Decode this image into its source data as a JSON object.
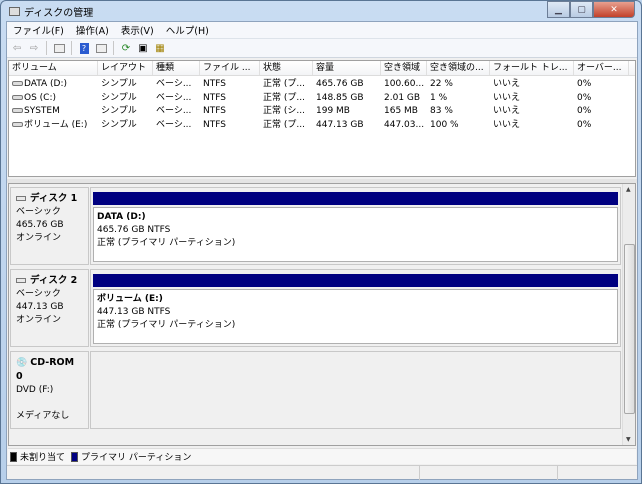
{
  "window": {
    "title": "ディスクの管理"
  },
  "menu": [
    "ファイル(F)",
    "操作(A)",
    "表示(V)",
    "ヘルプ(H)"
  ],
  "toolbar": [
    "back",
    "forward",
    "show-hide-console",
    "help",
    "properties",
    "refresh",
    "properties-sheet",
    "rescan"
  ],
  "table": {
    "headers": [
      "ボリューム",
      "レイアウト",
      "種類",
      "ファイル ...",
      "状態",
      "容量",
      "空き領域",
      "空き領域の...",
      "フォールト トレ...",
      "オーバー..."
    ],
    "rows": [
      [
        "DATA (D:)",
        "シンプル",
        "ベーシ...",
        "NTFS",
        "正常 (プ...",
        "465.76 GB",
        "100.60...",
        "22 %",
        "いいえ",
        "0%"
      ],
      [
        "OS (C:)",
        "シンプル",
        "ベーシ...",
        "NTFS",
        "正常 (プ...",
        "148.85 GB",
        "2.01 GB",
        "1 %",
        "いいえ",
        "0%"
      ],
      [
        "SYSTEM",
        "シンプル",
        "ベーシ...",
        "NTFS",
        "正常 (シ...",
        "199 MB",
        "165 MB",
        "83 %",
        "いいえ",
        "0%"
      ],
      [
        "ボリューム (E:)",
        "シンプル",
        "ベーシ...",
        "NTFS",
        "正常 (プ...",
        "447.13 GB",
        "447.03...",
        "100 %",
        "いいえ",
        "0%"
      ]
    ]
  },
  "disks": [
    {
      "name": "ディスク 1",
      "type": "ベーシック",
      "size": "465.76 GB",
      "status": "オンライン",
      "partition": {
        "name": "DATA  (D:)",
        "size": "465.76 GB NTFS",
        "status": "正常 (プライマリ パーティション)"
      }
    },
    {
      "name": "ディスク 2",
      "type": "ベーシック",
      "size": "447.13 GB",
      "status": "オンライン",
      "partition": {
        "name": "ボリューム  (E:)",
        "size": "447.13 GB NTFS",
        "status": "正常 (プライマリ パーティション)"
      }
    }
  ],
  "cdrom": {
    "name": "CD-ROM 0",
    "drive": "DVD (F:)",
    "status": "メディアなし"
  },
  "legend": [
    {
      "label": "未割り当て",
      "color": "#000000"
    },
    {
      "label": "プライマリ パーティション",
      "color": "#000080"
    }
  ]
}
